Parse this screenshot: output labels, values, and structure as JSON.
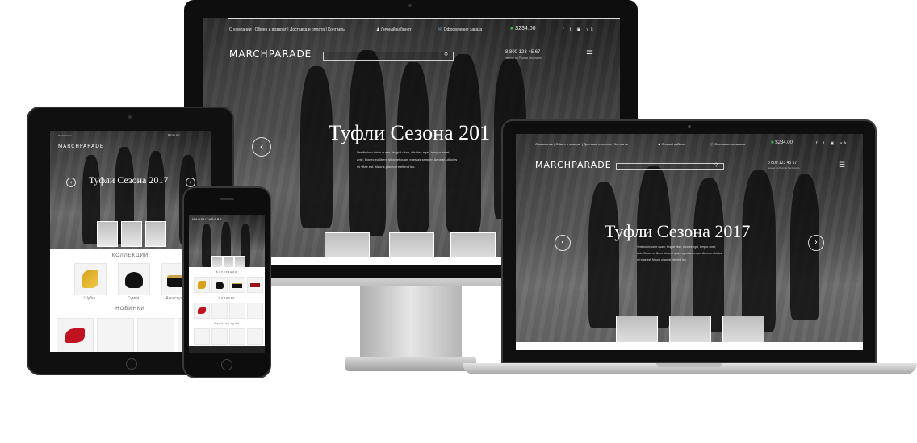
{
  "site": {
    "brand": "MARCHPARADE",
    "brand_small": "MARCHPARADE",
    "nav": [
      "О компании",
      "Обмен и возврат",
      "Доставка и оплата",
      "Контакты"
    ],
    "account": "Личный кабинет",
    "cart_label": "Оформление заказа",
    "cart_total": "$234.00",
    "phone": "8 800 123 45 67",
    "phone_note": "звонок по России бесплатно",
    "social": [
      "f",
      "t",
      "ig",
      "vk"
    ],
    "hero_title": "Туфли Сезона 2017",
    "hero_title_monitor": "Туфли Сезона 201",
    "hero_lines": [
      "Vestibulum tortor quam, feugiat vitae, ultricies eget, tempor amet,",
      "ante. Donec eu libero sit amet quam egestas semper. Aenean ultricies",
      "mi vitae est. Mauris placerat eleifend leo."
    ]
  },
  "tablet": {
    "section_collections": "КОЛЛЕКЦИИ",
    "section_new": "НОВИНКИ",
    "product_labels": [
      "Шубы",
      "Сумки",
      "Аксессуары"
    ]
  },
  "phone": {
    "section_collections": "Коллекции",
    "section_new": "Новинки",
    "section_bestsellers": "Хиты продаж"
  },
  "colors": {
    "frame": "#111111",
    "silver": "#c8c8c8",
    "accent_green": "#3bb54a"
  }
}
